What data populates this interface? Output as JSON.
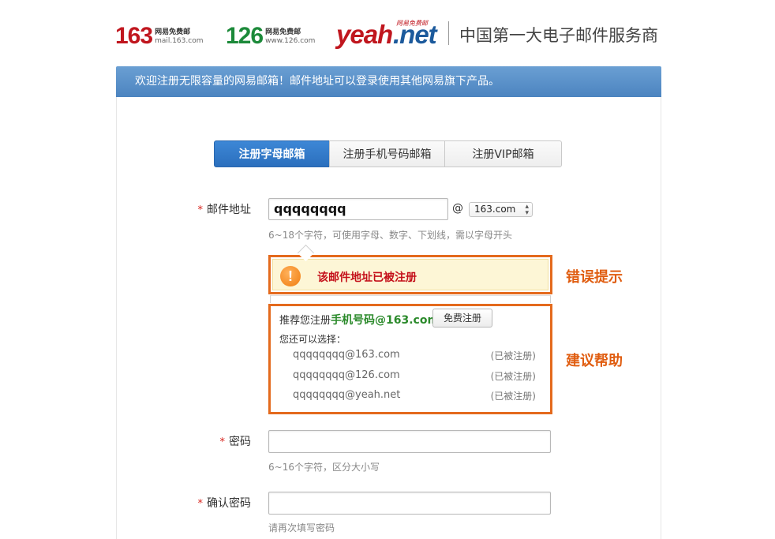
{
  "header": {
    "logo163": {
      "number": "163",
      "cn": "网易免费邮",
      "url": "mail.163.com"
    },
    "logo126": {
      "number": "126",
      "cn": "网易免费邮",
      "url": "www.126.com"
    },
    "logoYeah": {
      "brand": "yeah",
      "tld": ".net",
      "cn": "网易免费邮"
    },
    "slogan": "中国第一大电子邮件服务商"
  },
  "banner": {
    "text": "欢迎注册无限容量的网易邮箱！邮件地址可以登录使用其他网易旗下产品。"
  },
  "tabs": [
    {
      "label": "注册字母邮箱",
      "active": true
    },
    {
      "label": "注册手机号码邮箱",
      "active": false
    },
    {
      "label": "注册VIP邮箱",
      "active": false
    }
  ],
  "form": {
    "email": {
      "required_mark": "*",
      "label": "邮件地址",
      "value": "qqqqqqqq",
      "at": "@",
      "domain": "163.com",
      "hint": "6~18个字符，可使用字母、数字、下划线，需以字母开头"
    },
    "error": {
      "icon": "!",
      "message": "该邮件地址已被注册"
    },
    "suggestion": {
      "prefix": "推荐您注册",
      "highlight": "手机号码@163.com",
      "button": "免费注册",
      "also_label": "您还可以选择：",
      "options": [
        {
          "address": "qqqqqqqq@163.com",
          "status": "(已被注册)"
        },
        {
          "address": "qqqqqqqq@126.com",
          "status": "(已被注册)"
        },
        {
          "address": "qqqqqqqq@yeah.net",
          "status": "(已被注册)"
        }
      ]
    },
    "password": {
      "required_mark": "*",
      "label": "密码",
      "value": "",
      "hint": "6~16个字符，区分大小写"
    },
    "confirm": {
      "required_mark": "*",
      "label": "确认密码",
      "value": "",
      "hint": "请再次填写密码"
    }
  },
  "annotations": {
    "error_note": "错误提示",
    "help_note": "建议帮助"
  },
  "colors": {
    "brand_red": "#c0161e",
    "brand_green": "#1c8a3a",
    "accent_orange": "#e46a1d",
    "tab_blue": "#2b6fbd"
  }
}
